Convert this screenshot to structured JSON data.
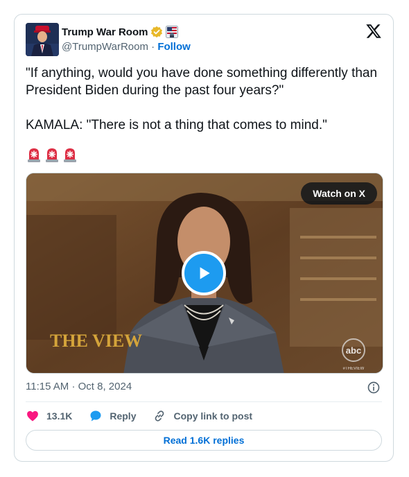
{
  "author": {
    "display_name": "Trump War Room",
    "handle": "@TrumpWarRoom",
    "separator": "·",
    "follow_label": "Follow",
    "verified_icon": "gold-verified-badge",
    "affiliate_icon": "affiliate-badge",
    "avatar_icon": "avatar-photo"
  },
  "tweet": {
    "text": "\"If anything, would you have done something differently than President Biden during the past four years?\"\n\nKAMALA: \"There is not a thing that comes to mind.\"",
    "emojis": [
      "rotating-light-emoji",
      "rotating-light-emoji",
      "rotating-light-emoji"
    ]
  },
  "media": {
    "watch_label": "Watch on X",
    "play_icon": "play-icon",
    "show_logo_text": "THE VIEW",
    "network_logo_text": "abc",
    "watermark_text": "#THEVIEW"
  },
  "meta": {
    "time": "11:15 AM",
    "separator": "·",
    "date": "Oct 8, 2024"
  },
  "actions": {
    "likes_count": "13.1K",
    "reply_label": "Reply",
    "copy_label": "Copy link to post",
    "read_replies_label": "Read 1.6K replies"
  },
  "colors": {
    "accent": "#1d9bf0",
    "link": "#006fd6",
    "like": "#f91880",
    "muted": "#536471"
  }
}
